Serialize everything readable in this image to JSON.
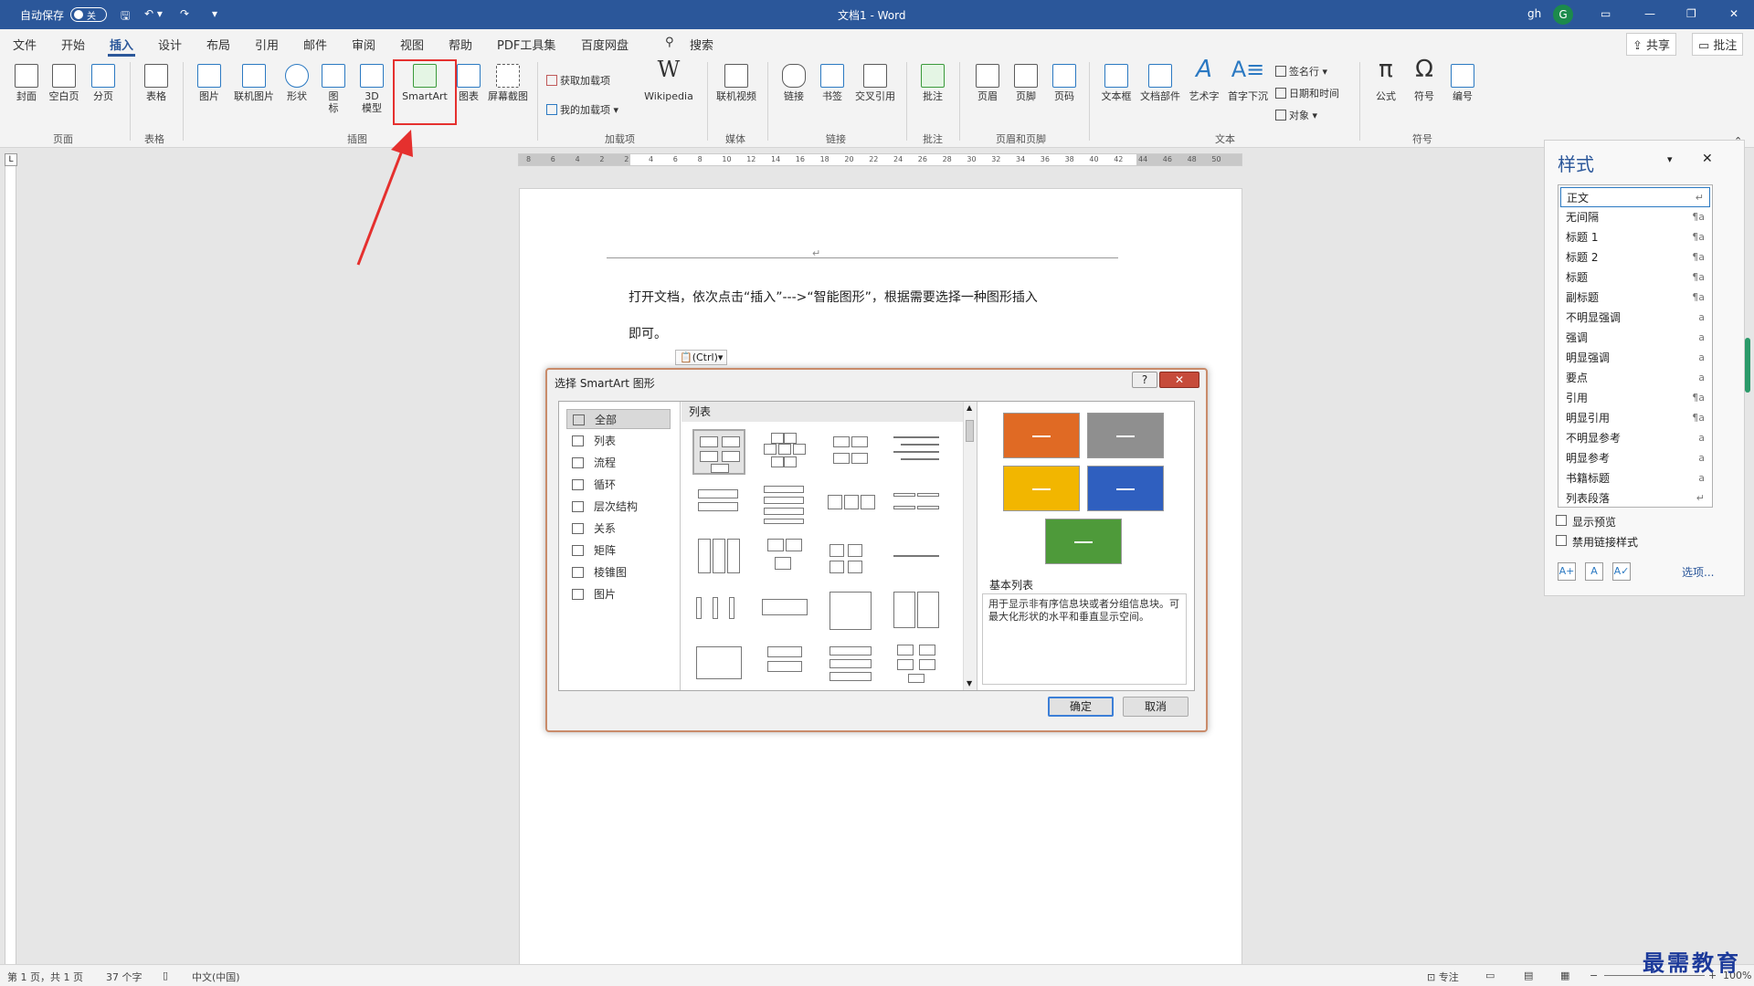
{
  "titlebar": {
    "autosave_label": "自动保存",
    "autosave_state": "关",
    "doc_title": "文档1 - Word",
    "user": "gh",
    "avatar_letter": "G"
  },
  "menu": {
    "items": [
      "文件",
      "开始",
      "插入",
      "设计",
      "布局",
      "引用",
      "邮件",
      "审阅",
      "视图",
      "帮助",
      "PDF工具集",
      "百度网盘"
    ],
    "search": "搜索",
    "share": "共享",
    "comment": "批注"
  },
  "ribbon": {
    "buttons": {
      "cover": "封面",
      "blank": "空白页",
      "pagebreak": "分页",
      "table": "表格",
      "picture": "图片",
      "online_picture": "联机图片",
      "shape": "形状",
      "icon": "图标",
      "model3d": "3D模型",
      "smartart": "SmartArt",
      "chart": "图表",
      "screenshot": "屏幕截图",
      "get_addins": "获取加载项",
      "my_addins": "我的加载项",
      "wikipedia": "Wikipedia",
      "online_video": "联机视频",
      "link": "链接",
      "bookmark": "书签",
      "crossref": "交叉引用",
      "comment": "批注",
      "header": "页眉",
      "footer": "页脚",
      "pagenum": "页码",
      "textbox": "文本框",
      "docparts": "文档部件",
      "wordart": "艺术字",
      "dropcap": "首字下沉",
      "signature": "签名行",
      "datetime": "日期和时间",
      "object": "对象",
      "equation": "公式",
      "symbol": "符号",
      "number": "编号"
    },
    "groups": {
      "pages": "页面",
      "tables": "表格",
      "illustrations": "插图",
      "addins": "加载项",
      "media": "媒体",
      "links": "链接",
      "comments": "批注",
      "headerfooter": "页眉和页脚",
      "text": "文本",
      "symbols": "符号"
    }
  },
  "ruler_ticks": [
    "8",
    "6",
    "4",
    "2",
    "2",
    "4",
    "6",
    "8",
    "10",
    "12",
    "14",
    "16",
    "18",
    "20",
    "22",
    "24",
    "26",
    "28",
    "30",
    "32",
    "34",
    "36",
    "38",
    "40",
    "42",
    "44",
    "46",
    "48",
    "50"
  ],
  "document": {
    "line1": "打开文档，依次点击“插入”--->“智能图形”，根据需要选择一种图形插入",
    "line2": "即可。",
    "paste_tag": "(Ctrl)"
  },
  "dialog": {
    "title": "选择 SmartArt 图形",
    "categories": [
      "全部",
      "列表",
      "流程",
      "循环",
      "层次结构",
      "关系",
      "矩阵",
      "棱锥图",
      "图片"
    ],
    "selected_category": "全部",
    "gallery_header": "列表",
    "preview_title": "基本列表",
    "preview_desc": "用于显示非有序信息块或者分组信息块。可最大化形状的水平和垂直显示空间。",
    "ok": "确定",
    "cancel": "取消",
    "preview_colors": [
      "#e06a24",
      "#8f8f8f",
      "#f2b600",
      "#2f5fbf",
      "#4e9a3a"
    ]
  },
  "stylepane": {
    "title": "样式",
    "styles": [
      {
        "name": "正文",
        "mark": "↵"
      },
      {
        "name": "无间隔",
        "mark": "¶a"
      },
      {
        "name": "标题 1",
        "mark": "¶a"
      },
      {
        "name": "标题 2",
        "mark": "¶a"
      },
      {
        "name": "标题",
        "mark": "¶a"
      },
      {
        "name": "副标题",
        "mark": "¶a"
      },
      {
        "name": "不明显强调",
        "mark": "a"
      },
      {
        "name": "强调",
        "mark": "a"
      },
      {
        "name": "明显强调",
        "mark": "a"
      },
      {
        "name": "要点",
        "mark": "a"
      },
      {
        "name": "引用",
        "mark": "¶a"
      },
      {
        "name": "明显引用",
        "mark": "¶a"
      },
      {
        "name": "不明显参考",
        "mark": "a"
      },
      {
        "name": "明显参考",
        "mark": "a"
      },
      {
        "name": "书籍标题",
        "mark": "a"
      },
      {
        "name": "列表段落",
        "mark": "↵"
      }
    ],
    "show_preview": "显示预览",
    "disable_linked": "禁用链接样式",
    "options": "选项..."
  },
  "status": {
    "page": "第 1 页，共 1 页",
    "words": "37 个字",
    "lang": "中文(中国)",
    "focus": "专注",
    "zoom": "100%"
  },
  "watermark": "最需教育",
  "accent": "#2b579a"
}
